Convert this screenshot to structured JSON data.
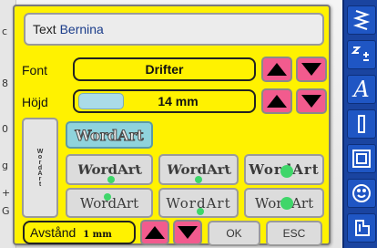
{
  "background": {
    "side_glyphs": [
      "c",
      "8",
      "0",
      "g",
      "h",
      "l",
      "+",
      "G"
    ]
  },
  "dialog": {
    "text_label": "Text",
    "text_value": "Bernina",
    "font": {
      "label": "Font",
      "value": "Drifter"
    },
    "height": {
      "label": "Höjd",
      "value": "14 mm",
      "level": 0.25
    },
    "wordart": {
      "vertical_label": "WordArt",
      "selected_label": "WordArt",
      "tiles": [
        "WordArt",
        "WordArt",
        "WordArt",
        "WordArt",
        "WordArt",
        "WordArt"
      ]
    },
    "spacing": {
      "label": "Avstånd",
      "value": "1 mm"
    },
    "ok_label": "OK",
    "esc_label": "ESC"
  },
  "toolbar": {
    "icons": [
      "zigzag-stitch-icon",
      "move-pattern-icon",
      "alphabet-icon",
      "straight-stitch-icon",
      "frame-icon",
      "smiley-icon",
      "presser-foot-icon"
    ],
    "letter_a": "A"
  },
  "colors": {
    "dialog_bg": "#fff200",
    "arrow_btn": "#f25b8e",
    "toolbar_bg": "#1a44a0",
    "selected_tile": "#8fd3dc",
    "handle_dot": "#3fd66a"
  }
}
